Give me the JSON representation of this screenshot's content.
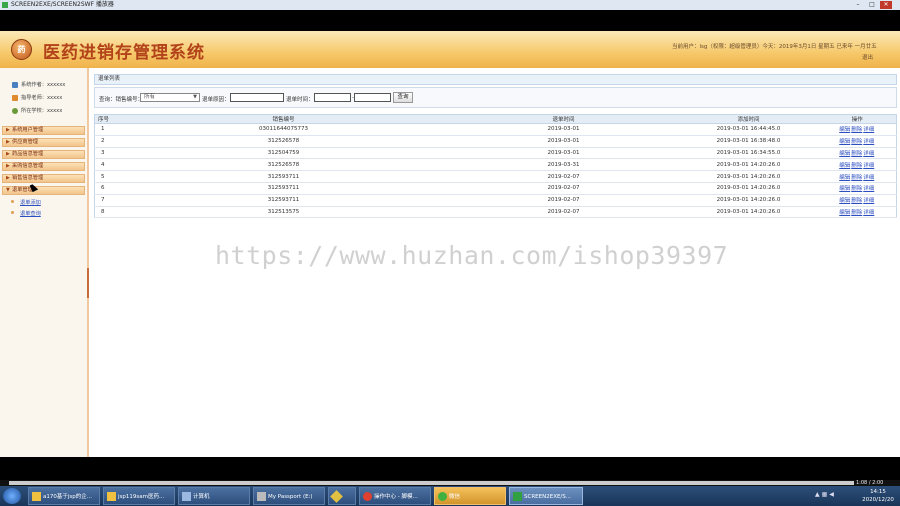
{
  "window": {
    "title": "SCREEN2EXE/SCREEN2SWF 播放器",
    "min": "–",
    "max": "□",
    "close": "✕"
  },
  "app": {
    "logo_text": "药",
    "title": "医药进销存管理系统",
    "user_info": "当前用户：lsg（权限：超级管理员）今天：2019年3月1日 星期五 已来年 一月廿五",
    "logout": "退出"
  },
  "sidebar": {
    "info": [
      {
        "label": "系统作者：xxxxxx",
        "icon": "user-group-icon",
        "color": "#4a7fc0"
      },
      {
        "label": "指导老师：xxxxx",
        "icon": "teacher-icon",
        "color": "#e08a30"
      },
      {
        "label": "所在学校：xxxxx",
        "icon": "school-icon",
        "color": "#6a9a3a"
      }
    ],
    "menus": [
      "系统用户管理",
      "供应商管理",
      "药品信息管理",
      "采购信息管理",
      "销售信息管理",
      "退单管理"
    ],
    "submenu": [
      "退单添加",
      "退单查询"
    ]
  },
  "panel": {
    "title": "退单列表"
  },
  "search": {
    "label": "查询：销售编号：",
    "select_value": "所有",
    "reason_label": "退单原因：",
    "time_label": "退单时间：",
    "time_sep": "-",
    "button": "查询"
  },
  "table": {
    "headers": [
      "序号",
      "销售编号",
      "退单时间",
      "添加时间",
      "操作"
    ],
    "rows": [
      [
        "1",
        "03011644075773",
        "2019-03-01",
        "2019-03-01 16:44:45.0"
      ],
      [
        "2",
        "312526578",
        "2019-03-01",
        "2019-03-01 16:38:48.0"
      ],
      [
        "3",
        "312504759",
        "2019-03-01",
        "2019-03-01 16:34:55.0"
      ],
      [
        "4",
        "312526578",
        "2019-03-31",
        "2019-03-01 14:20:26.0"
      ],
      [
        "5",
        "312593711",
        "2019-02-07",
        "2019-03-01 14:20:26.0"
      ],
      [
        "6",
        "312593711",
        "2019-02-07",
        "2019-03-01 14:20:26.0"
      ],
      [
        "7",
        "312593711",
        "2019-02-07",
        "2019-03-01 14:20:26.0"
      ],
      [
        "8",
        "312513575",
        "2019-02-07",
        "2019-03-01 14:20:26.0"
      ]
    ],
    "ops": [
      "编辑",
      "删除",
      "详细"
    ]
  },
  "watermark": "https://www.huzhan.com/ishop39397",
  "player": {
    "time": "1:08 / 2:00"
  },
  "taskbar": {
    "items": [
      {
        "label": "a170基于jsp的企...",
        "color": "#f0c040"
      },
      {
        "label": "jsp119sam医药...",
        "color": "#f0c040"
      },
      {
        "label": "计算机",
        "color": "#9ab8e0"
      },
      {
        "label": "My Passport (E:)",
        "color": "#bbbbbb"
      },
      {
        "label": "",
        "color": "#e0c040"
      },
      {
        "label": "操作中心 - 脚模...",
        "color": "#e04030"
      },
      {
        "label": "微信",
        "color": "#40b040"
      },
      {
        "label": "SCREEN2EXE/S...",
        "color": "#30a040"
      }
    ],
    "clock_time": "14:15",
    "clock_date": "2020/12/20"
  }
}
